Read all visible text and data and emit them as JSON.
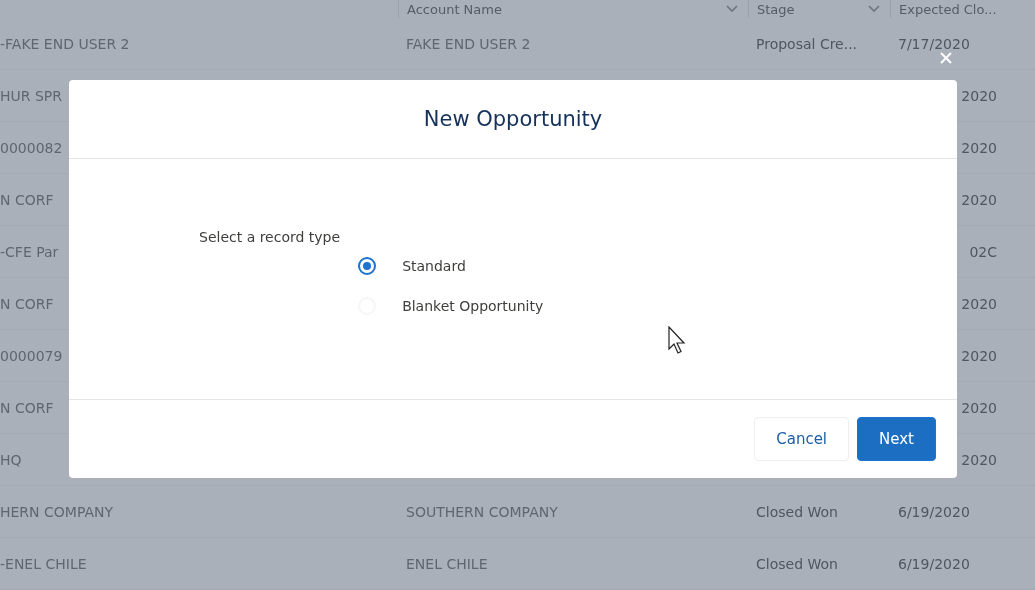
{
  "table": {
    "columns": [
      "Account Name",
      "Stage",
      "Expected Clo..."
    ],
    "rows": [
      {
        "name": "-FAKE END USER 2",
        "account": "FAKE END USER 2",
        "stage": "Proposal Cre...",
        "close": "7/17/2020"
      },
      {
        "name": "HUR SPR",
        "close": "2020"
      },
      {
        "name": "0000082",
        "close": "2020"
      },
      {
        "name": "N CORF",
        "close": "2020"
      },
      {
        "name": "-CFE Par",
        "close": "02C"
      },
      {
        "name": "N CORF",
        "close": "2020"
      },
      {
        "name": "0000079",
        "close": "2020"
      },
      {
        "name": "N CORF",
        "close": "2020"
      },
      {
        "name": "HQ",
        "close": "2020"
      },
      {
        "name": "HERN COMPANY",
        "account": "SOUTHERN COMPANY",
        "stage": "Closed Won",
        "close": "6/19/2020"
      },
      {
        "name": "-ENEL CHILE",
        "account": "ENEL CHILE",
        "stage": "Closed Won",
        "close": "6/19/2020"
      }
    ]
  },
  "modal": {
    "title": "New Opportunity",
    "prompt": "Select a record type",
    "options": [
      {
        "label": "Standard",
        "selected": true
      },
      {
        "label": "Blanket Opportunity",
        "selected": false
      }
    ],
    "buttons": [
      {
        "label": "Cancel",
        "kind": "neutral"
      },
      {
        "label": "Next",
        "kind": "brand"
      }
    ]
  }
}
